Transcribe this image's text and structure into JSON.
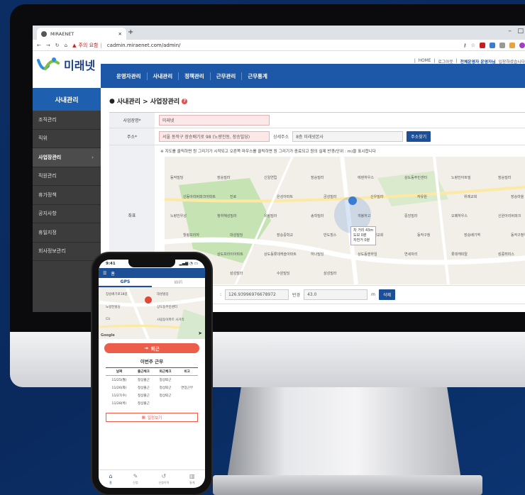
{
  "browser": {
    "tab_title": "MIRAENET",
    "warning": "주의 요함",
    "url": "cadmin.miraenet.com/admin/"
  },
  "top_links": {
    "home": "HOME",
    "logout": "로그아웃",
    "welcome_user": "전체운영자 운영자님",
    "welcome_suffix": "입장하셨습니다"
  },
  "brand": {
    "logo_text": "미래넷",
    "colors": {
      "primary": "#1d58a8",
      "accent": "#ec5d4a",
      "sidebar": "#3c3c3c"
    }
  },
  "gnb": [
    "운영자관리",
    "사내관리",
    "정책관리",
    "근무관리",
    "근무통계"
  ],
  "sidebar": {
    "title": "사내관리",
    "items": [
      "조직관리",
      "직위",
      "사업장관리",
      "직원관리",
      "휴가정책",
      "공지사항",
      "휴일지정",
      "회사정보관리"
    ],
    "active_index": 2
  },
  "page": {
    "title": "사내관리 > 사업장관리",
    "fields": {
      "name_label": "사업장명*",
      "name_value": "미래넷",
      "addr_label": "주소*",
      "addr_value": "서울 동작구 장승배기로 98 (노량진동, 장승빌딩)",
      "detail_label": "상세주소",
      "detail_value": "8층 미래넷본사",
      "search_button": "주소찾기",
      "coord_label": "좌표",
      "map_note": "※ 지도를 클릭하면 원 그리기가 시작되고 오른쪽 마우스를 클릭하면 원 그리기가 종료되고 원의 실제 반경(단위 : m)을 표시합니다",
      "lng_value": "126.93996976678972",
      "radius_label": "반경",
      "radius_value": "43.0",
      "radius_unit": "m",
      "delete_button": "삭제"
    },
    "map_labels": [
      "동작빌딩",
      "장승빌라",
      "신일연립",
      "장승빌라",
      "에덴하우스",
      "상도동주민센터",
      "노량진아트빌",
      "장승빌라",
      "신동아리버파크아파트",
      "진로",
      "은성아파트",
      "금성빌라",
      "신우빌라",
      "자유원",
      "위례교회",
      "장승마을",
      "노량진우성",
      "청하혜성빌라",
      "유림빌라",
      "송학빌라",
      "개봉하고",
      "중앙빌라",
      "오페하우스",
      "신원아리버파크",
      "힐링프라자",
      "대성빌딩",
      "장승중학교",
      "반도힐스",
      "세원교회",
      "동작구청",
      "장승배기역",
      "동작구청역",
      "상도주공아파트",
      "상도프라이아파트",
      "상도동롯데캐슬아파트",
      "하나빌딩",
      "상도동엔하임",
      "연세자리",
      "롯데캐피탈",
      "킹콩취미스",
      "석빌",
      "삼성빌라",
      "수원빌딩",
      "삼성빌라"
    ],
    "walk_chip": {
      "car": "차 거리 43m",
      "walk": "도보 0분",
      "bike": "자전거 0분"
    }
  },
  "phone": {
    "time": "9:41",
    "menu_title": "홈",
    "tabs": [
      "GPS",
      "WiFi"
    ],
    "map_labels": [
      "장승배기로18길",
      "대성빌딩",
      "노량진빌딩",
      "상도동주민센터",
      "CU",
      "사림동아파트 사거리"
    ],
    "map_attribution": "Google",
    "checkout_button": "퇴근",
    "week_title": "이번주 근무",
    "table_headers": [
      "날짜",
      "출근체크",
      "퇴근체크",
      "비고"
    ],
    "rows": [
      [
        "11/25(월)",
        "정상출근",
        "정상퇴근",
        ""
      ],
      [
        "11/26(화)",
        "정상출근",
        "정상퇴근",
        "연장근무"
      ],
      [
        "11/27(수)",
        "정상출근",
        "정상퇴근",
        ""
      ],
      [
        "11/28(목)",
        "정상출근",
        "",
        ""
      ]
    ],
    "detail_button": "일정보기",
    "footer": [
      "홈",
      "신청",
      "신청이력",
      "통계"
    ],
    "footer_active": 0
  }
}
